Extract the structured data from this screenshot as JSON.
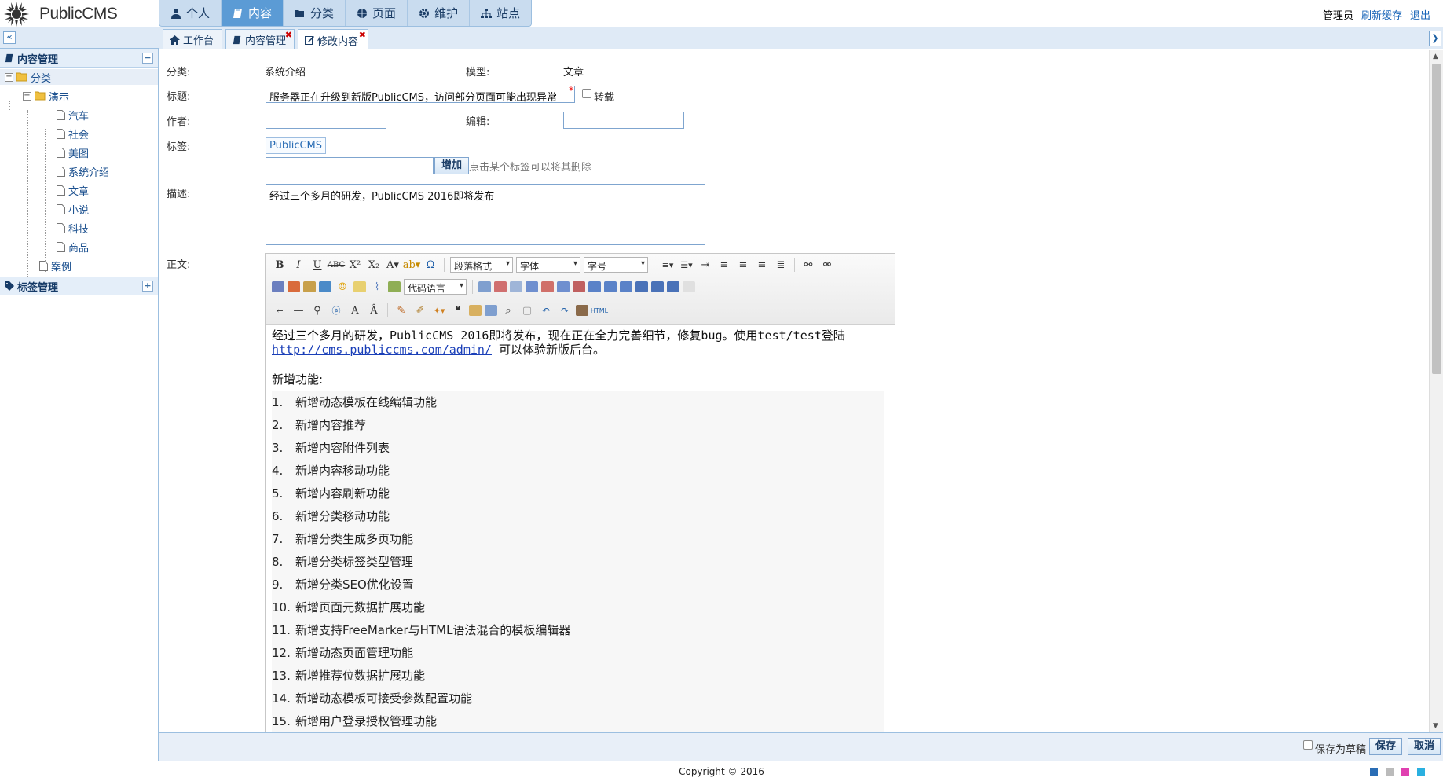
{
  "app": {
    "logo_text": "PublicCMS"
  },
  "topnav": [
    {
      "label": "个人",
      "icon": "user-icon",
      "active": false
    },
    {
      "label": "内容",
      "icon": "book-icon",
      "active": true
    },
    {
      "label": "分类",
      "icon": "folder-icon",
      "active": false
    },
    {
      "label": "页面",
      "icon": "globe-icon",
      "active": false
    },
    {
      "label": "维护",
      "icon": "gear-icon",
      "active": false
    },
    {
      "label": "站点",
      "icon": "sitemap-icon",
      "active": false
    }
  ],
  "userbar": {
    "user": "管理员",
    "refresh": "刷新缓存",
    "logout": "退出"
  },
  "sidebar": {
    "collapse_glyph": "«",
    "content_panel": {
      "title": "内容管理",
      "toggle": "−"
    },
    "tree": {
      "root": "分类",
      "demo": "演示",
      "children": [
        "汽车",
        "社会",
        "美图",
        "系统介绍",
        "文章",
        "小说",
        "科技",
        "商品"
      ],
      "case": "案例"
    },
    "tag_panel": {
      "title": "标签管理",
      "toggle": "+"
    }
  },
  "tabs": [
    {
      "label": "工作台",
      "icon": "home-icon",
      "closable": false
    },
    {
      "label": "内容管理",
      "icon": "book-icon",
      "closable": true
    },
    {
      "label": "修改内容",
      "icon": "edit-icon",
      "closable": true,
      "active": true
    }
  ],
  "form": {
    "category_label": "分类:",
    "category_value": "系统介绍",
    "model_label": "模型:",
    "model_value": "文章",
    "title_label": "标题:",
    "title_value": "服务器正在升级到新版PublicCMS，访问部分页面可能出现异常",
    "required_mark": "*",
    "repost_label": "转载",
    "author_label": "作者:",
    "author_value": "",
    "editor_label": "编辑:",
    "editor_value": "",
    "tags_label": "标签:",
    "tag_items": [
      "PublicCMS"
    ],
    "tag_input_value": "",
    "add_button": "增加",
    "tag_hint": "点击某个标签可以将其删除",
    "desc_label": "描述:",
    "desc_value": "经过三个多月的研发，PublicCMS 2016即将发布",
    "body_label": "正文:"
  },
  "editor": {
    "selects": {
      "paragraph": "段落格式",
      "font": "字体",
      "size": "字号",
      "code": "代码语言"
    },
    "intro_text": "经过三个多月的研发，PublicCMS 2016即将发布，现在正在全力完善细节，修复bug。使用test/test登陆",
    "intro_link": "http://cms.publiccms.com/admin/",
    "intro_tail": " 可以体验新版后台。",
    "features_title": "新增功能:",
    "features": [
      "新增动态模板在线编辑功能",
      "新增内容推荐",
      "新增内容附件列表",
      "新增内容移动功能",
      "新增内容刷新功能",
      "新增分类移动功能",
      "新增分类生成多页功能",
      "新增分类标签类型管理",
      "新增分类SEO优化设置",
      "新增页面元数据扩展功能",
      "新增支持FreeMarker与HTML语法混合的模板编辑器",
      "新增动态页面管理功能",
      "新增推荐位数据扩展功能",
      "新增动态模板可接受参数配置功能",
      "新增用户登录授权管理功能"
    ]
  },
  "actions": {
    "draft_label": "保存为草稿",
    "save": "保存",
    "cancel": "取消"
  },
  "footer": {
    "copyright": "Copyright © 2016",
    "theme_colors": [
      "#2a6db5",
      "#bbbbbb",
      "#e040b0",
      "#2ab0e0"
    ]
  }
}
